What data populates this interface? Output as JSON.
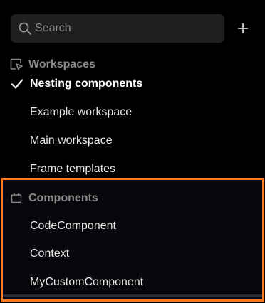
{
  "search": {
    "placeholder": "Search",
    "value": ""
  },
  "toolbar": {
    "add_icon": "plus-icon"
  },
  "workspaces": {
    "header": "Workspaces",
    "icon": "cursor-frame-icon",
    "items": [
      {
        "label": "Nesting components",
        "selected": true
      },
      {
        "label": "Example workspace",
        "selected": false
      },
      {
        "label": "Main workspace",
        "selected": false
      },
      {
        "label": "Frame templates",
        "selected": false
      }
    ]
  },
  "components": {
    "header": "Components",
    "icon": "component-box-icon",
    "items": [
      {
        "label": "CodeComponent"
      },
      {
        "label": "Context"
      },
      {
        "label": "MyCustomComponent"
      }
    ]
  },
  "colors": {
    "background": "#000000",
    "search_bg": "#1f1f1f",
    "highlight": "#ff7a22",
    "header_text": "#8a8a8a",
    "item_text": "#e6e6e6"
  }
}
